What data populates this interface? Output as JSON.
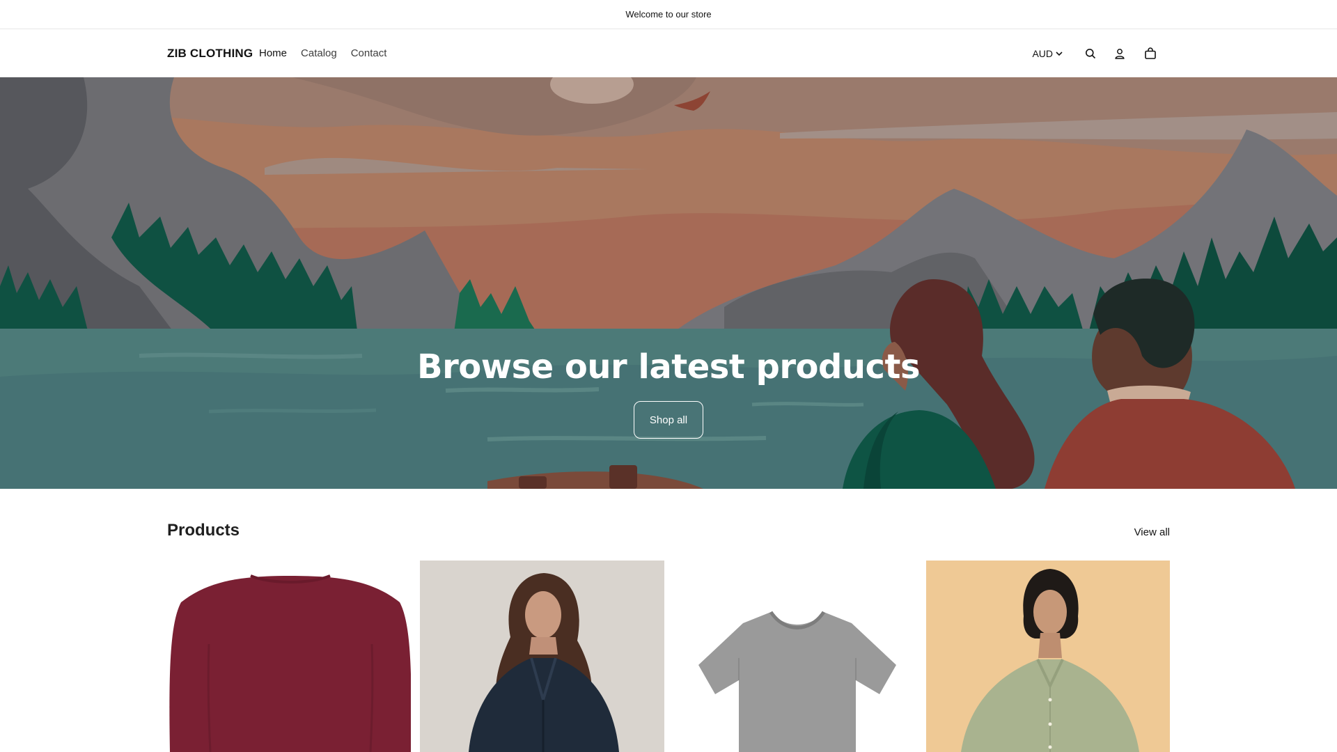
{
  "announcement": {
    "text": "Welcome to our store"
  },
  "header": {
    "brand": "ZIB CLOTHING",
    "nav": [
      {
        "label": "Home",
        "active": true
      },
      {
        "label": "Catalog",
        "active": false
      },
      {
        "label": "Contact",
        "active": false
      }
    ],
    "currency": "AUD",
    "icons": [
      "search-icon",
      "account-icon",
      "cart-icon",
      "chevron-down-icon"
    ]
  },
  "hero": {
    "title": "Browse our latest products",
    "button_label": "Shop all"
  },
  "products": {
    "title": "Products",
    "view_all_label": "View all",
    "items": [
      {
        "image": "burgundy long-sleeve top"
      },
      {
        "image": "woman in navy shirt"
      },
      {
        "image": "grey t-shirt"
      },
      {
        "image": "woman in sage green shirt"
      }
    ]
  },
  "colors": {
    "water": "#467274",
    "trees": "#0f5142",
    "sky": "#a9785f",
    "text_dark": "#121212"
  }
}
